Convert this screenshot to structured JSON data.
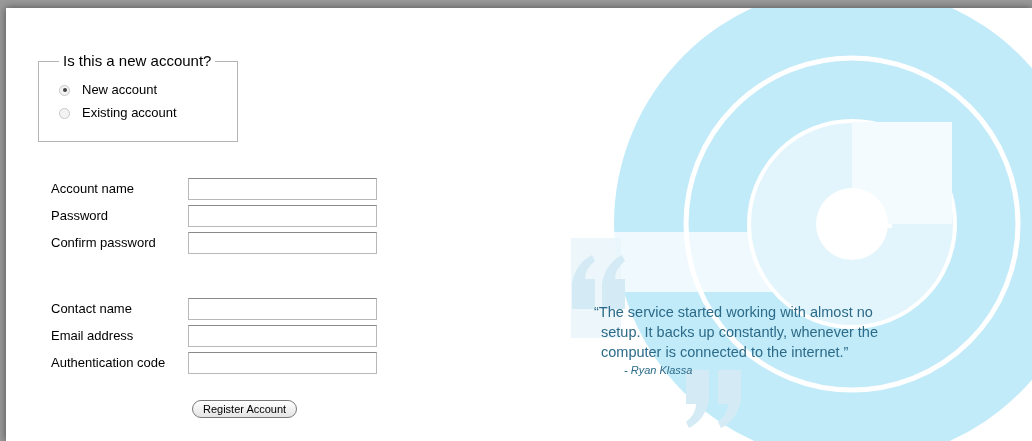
{
  "account_type": {
    "legend": "Is this a new account?",
    "options": [
      {
        "label": "New account",
        "selected": true
      },
      {
        "label": "Existing account",
        "selected": false
      }
    ]
  },
  "account_fields": [
    {
      "label": "Account name"
    },
    {
      "label": "Password"
    },
    {
      "label": "Confirm password"
    }
  ],
  "contact_fields": [
    {
      "label": "Contact name"
    },
    {
      "label": "Email address"
    },
    {
      "label": "Authentication code"
    }
  ],
  "submit": {
    "label": "Register Account"
  },
  "testimonial": {
    "quote": "“The service started working with almost no setup. It backs up constantly, whenever the computer is connected to the internet.”",
    "author": "- Ryan Klassa"
  }
}
